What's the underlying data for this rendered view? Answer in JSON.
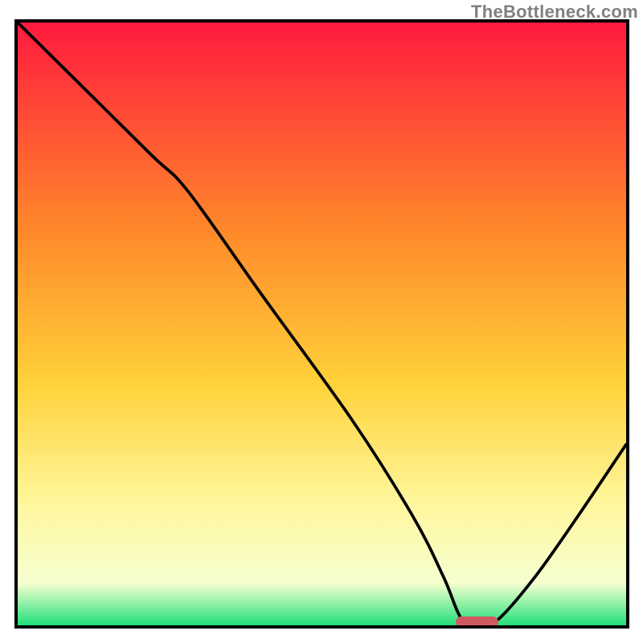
{
  "watermark": "TheBottleneck.com",
  "colors": {
    "top": "#ff1a3e",
    "upper_mid": "#ff8a2a",
    "mid": "#ffd23a",
    "lower_mid": "#fff79e",
    "near_bottom": "#f6ffd0",
    "bottom": "#22e07a",
    "line": "#000000",
    "marker": "#cf5b61"
  },
  "chart_data": {
    "type": "line",
    "title": "",
    "xlabel": "",
    "ylabel": "",
    "xlim": [
      0,
      100
    ],
    "ylim": [
      0,
      100
    ],
    "note": "x/y are read as percentages across the plot area (0,0 = bottom-left). The curve starts at the top-left, dips to ~0 around x≈73–79, then rises to the right edge.",
    "series": [
      {
        "name": "curve",
        "x": [
          0,
          10,
          22,
          28,
          40,
          55,
          65,
          70,
          73,
          76,
          79,
          85,
          92,
          100
        ],
        "y": [
          100,
          90,
          78,
          72,
          55,
          34,
          18,
          8,
          1,
          0,
          1,
          8,
          18,
          30
        ]
      }
    ],
    "marker": {
      "x_start_pct": 72,
      "x_end_pct": 79,
      "y_pct": 0.5
    },
    "gradient_stops": [
      {
        "offset": 0.0,
        "key": "top"
      },
      {
        "offset": 0.35,
        "key": "upper_mid"
      },
      {
        "offset": 0.6,
        "key": "mid"
      },
      {
        "offset": 0.8,
        "key": "lower_mid"
      },
      {
        "offset": 0.93,
        "key": "near_bottom"
      },
      {
        "offset": 1.0,
        "key": "bottom"
      }
    ]
  }
}
